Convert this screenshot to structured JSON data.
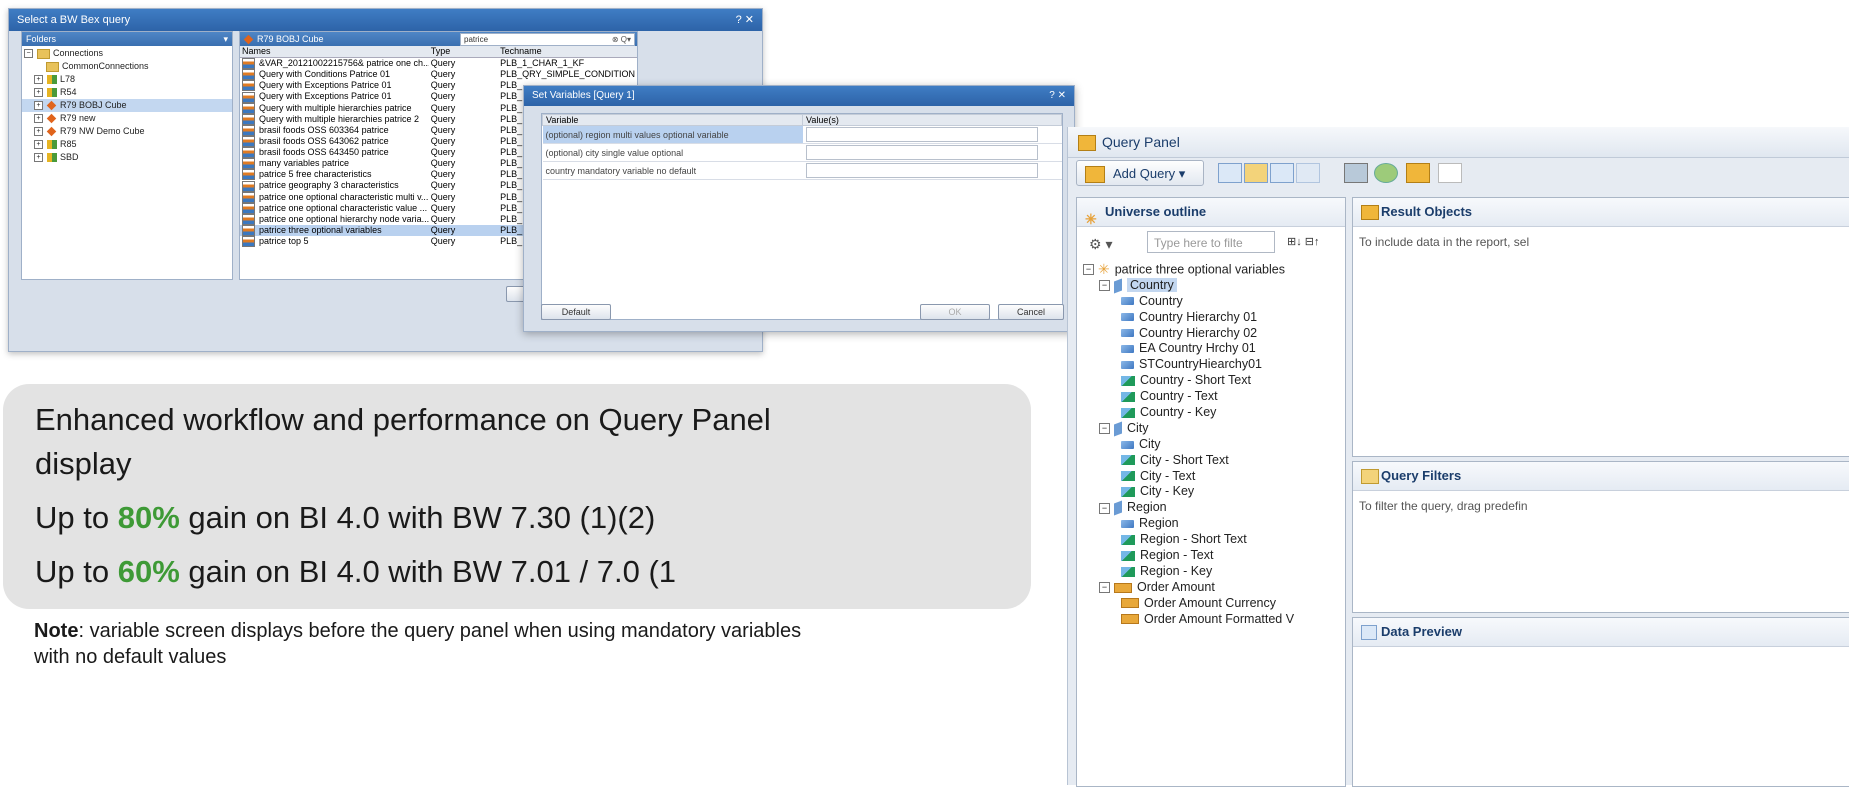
{
  "bex_dialog": {
    "title": "Select a BW Bex query",
    "folders_header": "Folders",
    "folders": [
      {
        "label": "Connections",
        "type": "folder"
      },
      {
        "label": "CommonConnections",
        "type": "folder"
      },
      {
        "label": "L78",
        "type": "bw"
      },
      {
        "label": "R54",
        "type": "bw"
      },
      {
        "label": "R79 BOBJ Cube",
        "type": "cube"
      },
      {
        "label": "R79 new",
        "type": "cube"
      },
      {
        "label": "R79 NW Demo Cube",
        "type": "cube"
      },
      {
        "label": "R85",
        "type": "bw"
      },
      {
        "label": "SBD",
        "type": "bw"
      }
    ],
    "list_header": "R79 BOBJ Cube",
    "search_value": "patrice",
    "columns": [
      "Names",
      "Type",
      "Techname"
    ],
    "rows": [
      [
        "&VAR_20121002215756& patrice one ch...",
        "Query",
        "PLB_1_CHAR_1_KF"
      ],
      [
        "Query with Conditions Patrice 01",
        "Query",
        "PLB_QRY_SIMPLE_CONDITION"
      ],
      [
        "Query with Exceptions Patrice 01",
        "Query",
        "PLB_"
      ],
      [
        "Query with Exceptions Patrice 01",
        "Query",
        "PLB_"
      ],
      [
        "Query with multiple hierarchies patrice",
        "Query",
        "PLB_"
      ],
      [
        "Query with multiple hierarchies patrice 2",
        "Query",
        "PLB_"
      ],
      [
        "brasil foods OSS 603364 patrice",
        "Query",
        "PLB_"
      ],
      [
        "brasil foods OSS 643062 patrice",
        "Query",
        "PLB_"
      ],
      [
        "brasil foods OSS 643450 patrice",
        "Query",
        "PLB_"
      ],
      [
        "many variables patrice",
        "Query",
        "PLB_"
      ],
      [
        "patrice 5 free characteristics",
        "Query",
        "PLB_"
      ],
      [
        "patrice geography 3 characteristics",
        "Query",
        "PLB_"
      ],
      [
        "patrice one optional characteristic multi v...",
        "Query",
        "PLB_"
      ],
      [
        "patrice one optional characteristic value ...",
        "Query",
        "PLB_"
      ],
      [
        "patrice one optional hierarchy node varia...",
        "Query",
        "PLB_"
      ],
      [
        "patrice three optional variables",
        "Query",
        "PLB_"
      ],
      [
        "patrice top 5",
        "Query",
        "PLB_"
      ]
    ]
  },
  "setvar_dialog": {
    "title": "Set Variables [Query 1]",
    "col_variable": "Variable",
    "col_values": "Value(s)",
    "variables": [
      "(optional) region multi values optional variable",
      "(optional) city single value optional",
      "country mandatory variable no default"
    ],
    "default_button": "Default",
    "ok_button": "OK",
    "cancel_button": "Cancel"
  },
  "query_panel": {
    "title": "Query Panel",
    "add_query": "Add Query",
    "universe_outline": "Universe outline",
    "filter_placeholder": "Type here to filte",
    "result_objects": "Result Objects",
    "result_hint": "To include data in the report, sel",
    "query_filters": "Query Filters",
    "filters_hint": "To filter the query, drag predefin",
    "data_preview": "Data Preview",
    "tree": [
      {
        "label": "patrice three optional variables",
        "level": 0,
        "icon": "universe"
      },
      {
        "label": "Country",
        "level": 1,
        "icon": "dimension",
        "selected": true
      },
      {
        "label": "Country",
        "level": 2,
        "icon": "hierarchy"
      },
      {
        "label": "Country Hierarchy 01",
        "level": 2,
        "icon": "attribute"
      },
      {
        "label": "Country Hierarchy 02",
        "level": 2,
        "icon": "attribute"
      },
      {
        "label": "EA Country Hrchy 01",
        "level": 2,
        "icon": "attribute"
      },
      {
        "label": "STCountryHiearchy01",
        "level": 2,
        "icon": "attribute"
      },
      {
        "label": "Country - Short Text",
        "level": 2,
        "icon": "text"
      },
      {
        "label": "Country - Text",
        "level": 2,
        "icon": "text"
      },
      {
        "label": "Country - Key",
        "level": 2,
        "icon": "text"
      },
      {
        "label": "City",
        "level": 1,
        "icon": "dimension"
      },
      {
        "label": "City",
        "level": 2,
        "icon": "hierarchy"
      },
      {
        "label": "City - Short Text",
        "level": 2,
        "icon": "text"
      },
      {
        "label": "City - Text",
        "level": 2,
        "icon": "text"
      },
      {
        "label": "City - Key",
        "level": 2,
        "icon": "text"
      },
      {
        "label": "Region",
        "level": 1,
        "icon": "dimension"
      },
      {
        "label": "Region",
        "level": 2,
        "icon": "hierarchy"
      },
      {
        "label": "Region - Short Text",
        "level": 2,
        "icon": "text"
      },
      {
        "label": "Region - Text",
        "level": 2,
        "icon": "text"
      },
      {
        "label": "Region - Key",
        "level": 2,
        "icon": "text"
      },
      {
        "label": "Order Amount",
        "level": 1,
        "icon": "measure"
      },
      {
        "label": "Order Amount Currency",
        "level": 2,
        "icon": "measure-attr"
      },
      {
        "label": "Order Amount Formatted V",
        "level": 2,
        "icon": "measure-attr"
      }
    ]
  },
  "callout": {
    "line1": "Enhanced workflow and performance on Query Panel",
    "line1b": "display",
    "line2_pre": "Up to ",
    "line2_pct": "80%",
    "line2_post": " gain on BI 4.0 with BW 7.30 (1)(2)",
    "line3_pre": "Up to ",
    "line3_pct": "60%",
    "line3_post": " gain on BI 4.0 with BW 7.01 / 7.0 (1"
  },
  "note": {
    "label": "Note",
    "text": ": variable screen displays before the query panel when using mandatory variables",
    "text2": "with no default values"
  }
}
